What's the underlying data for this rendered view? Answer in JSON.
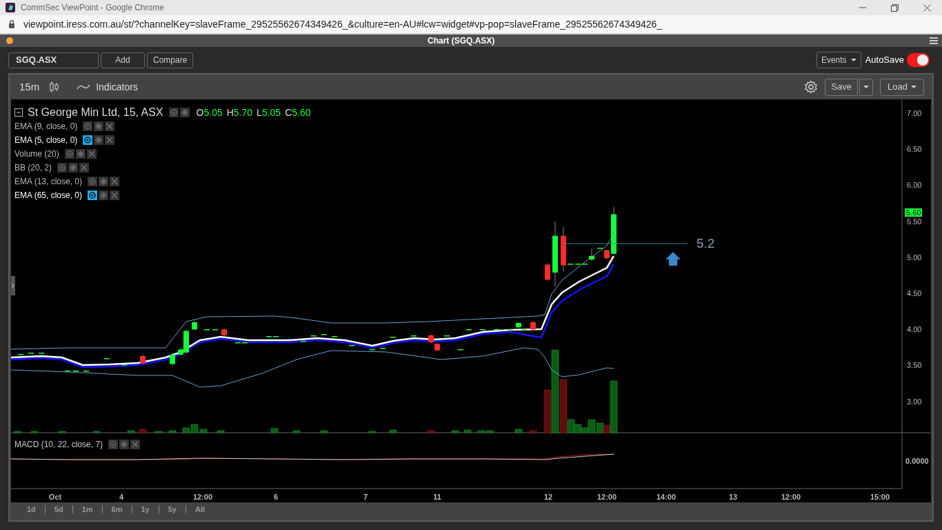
{
  "browser": {
    "title": "CommSec ViewPoint - Google Chrome",
    "url": "viewpoint.iress.com.au/st/?channelKey=slaveFrame_29525562674349426_&culture=en-AU#lcw=widget#vp-pop=slaveFrame_29525562674349426_"
  },
  "panel": {
    "title": "Chart (SGQ.ASX)"
  },
  "toolbar": {
    "symbol": "SGQ.ASX",
    "buttons": [
      "Add",
      "Compare"
    ],
    "events": "Events",
    "autosave": {
      "label": "AutoSave",
      "on": true
    }
  },
  "chart_toolbar": {
    "interval": "15m",
    "indicators": "Indicators",
    "save": "Save",
    "load": "Load"
  },
  "legend": {
    "title": "St George Min Ltd, 15, ASX",
    "ohlc": [
      {
        "label": "O",
        "value": "5.05"
      },
      {
        "label": "H",
        "value": "5.70"
      },
      {
        "label": "L",
        "value": "5.05"
      },
      {
        "label": "C",
        "value": "5.60"
      }
    ],
    "indicators": [
      {
        "label": "EMA (9, close, 0)",
        "visible": false
      },
      {
        "label": "EMA (5, close, 0)",
        "visible": true
      },
      {
        "label": "Volume (20)",
        "visible": false
      },
      {
        "label": "BB (20, 2)",
        "visible": false
      },
      {
        "label": "EMA (13, close, 0)",
        "visible": false
      },
      {
        "label": "EMA (65, close, 0)",
        "visible": true
      }
    ]
  },
  "price_axis": [
    "7.00",
    "6.50",
    "6.00",
    "5.50",
    "5.00",
    "4.50",
    "4.00",
    "3.50",
    "3.00"
  ],
  "last_price": "5.60",
  "annotation": "5.2",
  "macd": {
    "label": "MACD (10, 22, close, 7)",
    "axis": "0.0000"
  },
  "time_axis": [
    "Oct",
    "4",
    "12:00",
    "6",
    "7",
    "11",
    "12",
    "12:00",
    "14:00",
    "13",
    "12:00",
    "15:00"
  ],
  "ranges": [
    "1d",
    "5d",
    "1m",
    "6m",
    "1y",
    "5y",
    "All"
  ]
}
